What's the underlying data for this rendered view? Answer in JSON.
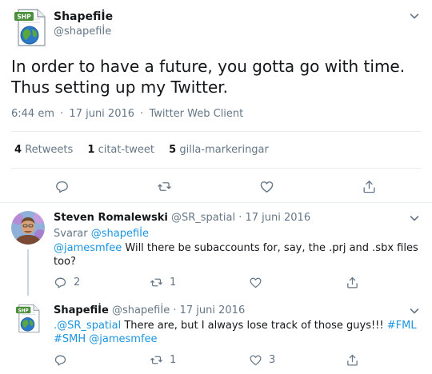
{
  "main_tweet": {
    "display_name": "Shapefiİe",
    "handle": "@shapefiİe",
    "text_line1": "In order to have a future, you gotta go with time.",
    "text_line2": "Thus setting up my Twitter.",
    "time": "6:44 em",
    "date": "17 juni 2016",
    "client": "Twitter Web Client",
    "separator": "·",
    "stats": {
      "retweets_count": "4",
      "retweets_label": "Retweets",
      "quotes_count": "1",
      "quotes_label": "citat-tweet",
      "likes_count": "5",
      "likes_label": "gilla-markeringar"
    }
  },
  "avatar_label": "SHP",
  "replies": [
    {
      "display_name": "Steven Romalewski",
      "handle": "@SR_spatial",
      "date": "17 juni 2016",
      "replying_prefix": "Svarar",
      "replying_to": "@shapefiİe",
      "mention": "@jamesmfee",
      "text": "Will there be subaccounts for, say, the .prj and .sbx files",
      "text_line2": "too?",
      "reply_count": "2",
      "retweet_count": "1",
      "like_count": ""
    },
    {
      "display_name": "Shapefiİe",
      "handle": "@shapefiİe",
      "date": "17 juni 2016",
      "mention": ".@SR_spatial",
      "text": "There are, but I always lose track of those guys!!!",
      "hashtag1": "#FML",
      "hashtag2": "#SMH",
      "mention2": "@jamesmfee",
      "reply_count": "",
      "retweet_count": "1",
      "like_count": "3"
    }
  ],
  "colors": {
    "link": "#1b95e0",
    "muted": "#657786",
    "text": "#14171a",
    "border": "#e6ecf0"
  }
}
